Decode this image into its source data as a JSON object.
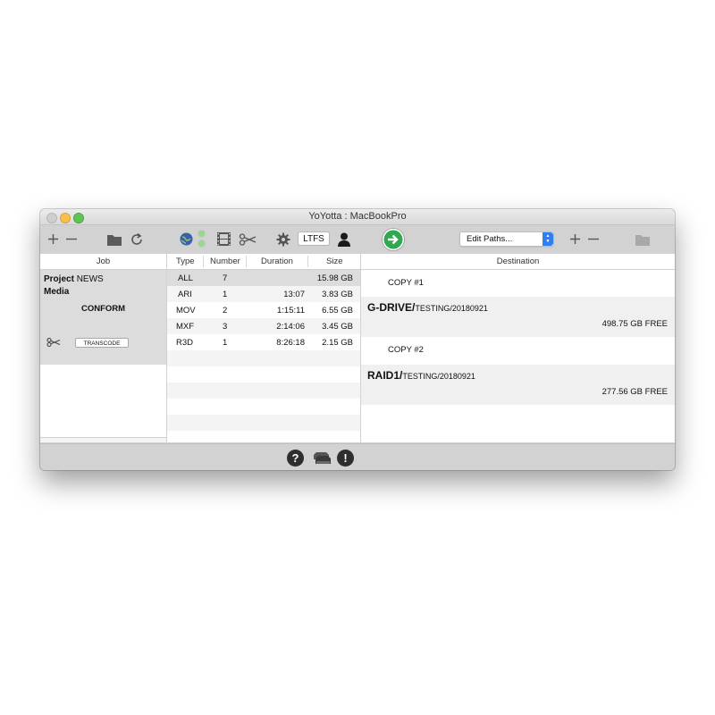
{
  "window": {
    "title": "YoYotta : MacBookPro"
  },
  "toolbar": {
    "ltfs_label": "LTFS",
    "edit_paths": {
      "selected": "Edit Paths..."
    },
    "icons": [
      "plus-icon",
      "minus-icon",
      "folder-icon",
      "refresh-icon",
      "globe-icon",
      "status-dots-icon",
      "film-icon",
      "scissors-icon",
      "gear-icon",
      "user-icon",
      "go-arrow-icon",
      "plus-icon",
      "minus-icon",
      "folder-icon"
    ]
  },
  "job_panel": {
    "header": "Job",
    "project_label": "Project",
    "project_value": "NEWS",
    "media_label": "Media",
    "conform_label": "CONFORM",
    "transcode_button": "TRANSCODE"
  },
  "type_table": {
    "columns": [
      "Type",
      "Number",
      "Duration",
      "Size"
    ],
    "rows": [
      {
        "type": "ALL",
        "number": "7",
        "duration": "",
        "size": "15.98 GB"
      },
      {
        "type": "ARI",
        "number": "1",
        "duration": "13:07",
        "size": "3.83 GB"
      },
      {
        "type": "MOV",
        "number": "2",
        "duration": "1:15:11",
        "size": "6.55 GB"
      },
      {
        "type": "MXF",
        "number": "3",
        "duration": "2:14:06",
        "size": "3.45 GB"
      },
      {
        "type": "R3D",
        "number": "1",
        "duration": "8:26:18",
        "size": "2.15 GB"
      }
    ]
  },
  "destination_panel": {
    "header": "Destination",
    "copies": [
      {
        "label": "COPY #1",
        "drive": "G-DRIVE/",
        "path": "TESTING/20180921",
        "free": "498.75 GB FREE"
      },
      {
        "label": "COPY #2",
        "drive": "RAID1/",
        "path": "TESTING/20180921",
        "free": "277.56 GB FREE"
      }
    ]
  },
  "bottom_bar": {
    "help_icon_glyph": "?",
    "alert_icon_glyph": "!"
  },
  "colors": {
    "accent_blue": "#2f7ff0",
    "go_green": "#2fa84f",
    "window_gray": "#d2d2d2",
    "selection_gray": "#dcdcdc"
  }
}
